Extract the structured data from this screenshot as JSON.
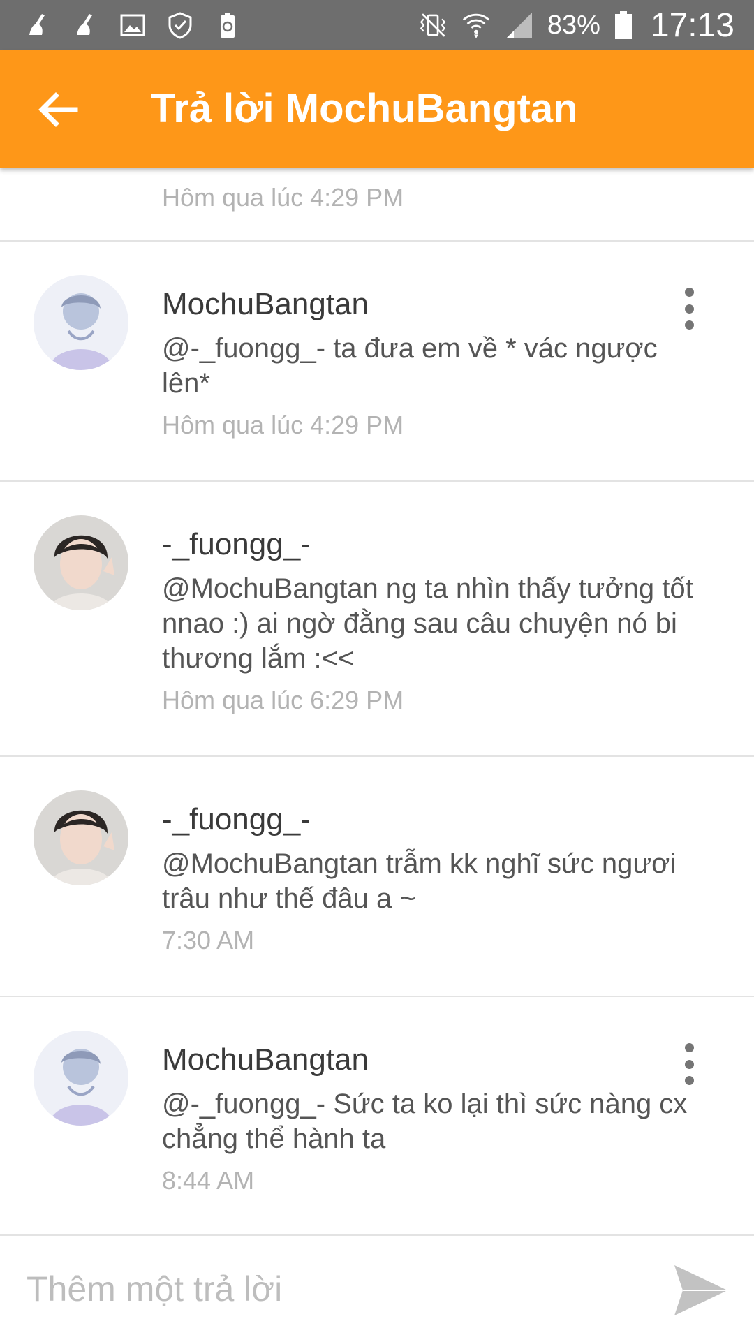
{
  "status_bar": {
    "battery_percent": "83%",
    "time": "17:13",
    "icons": [
      "cleaner-icon",
      "cleaner-icon",
      "gallery-icon",
      "shield-icon",
      "battery-saver-icon",
      "vibrate-icon",
      "wifi-icon",
      "signal-icon",
      "battery-icon"
    ]
  },
  "app_bar": {
    "title": "Trả lời MochuBangtan",
    "back_icon": "arrow-left-icon",
    "background": "#fe9718"
  },
  "partial_comment": {
    "time": "Hôm qua lúc 4:29 PM"
  },
  "comments": [
    {
      "username": "MochuBangtan",
      "text": "@-_fuongg_-   ta đưa em về * vác ngược lên*",
      "time": "Hôm qua lúc 4:29 PM",
      "avatar": "avatar-mochubangtan",
      "has_menu": true
    },
    {
      "username": "-_fuongg_-",
      "text": "@MochuBangtan ng ta nhìn thấy tưởng tốt nnao :) ai ngờ đằng sau câu chuyện nó bi thương lắm :<<",
      "time": "Hôm qua lúc 6:29 PM",
      "avatar": "avatar-fuongg",
      "has_menu": false
    },
    {
      "username": "-_fuongg_-",
      "text": "@MochuBangtan trẫm kk nghĩ sức ngươi trâu như thế đâu a ~",
      "time": "7:30 AM",
      "avatar": "avatar-fuongg",
      "has_menu": false
    },
    {
      "username": "MochuBangtan",
      "text": "@-_fuongg_-   Sức ta ko lại thì sức nàng cx chẳng thể hành ta",
      "time": "8:44 AM",
      "avatar": "avatar-mochubangtan",
      "has_menu": true
    }
  ],
  "reply_bar": {
    "placeholder": "Thêm một trả lời",
    "send_icon": "send-icon"
  },
  "colors": {
    "accent": "#fe9718",
    "status_bar": "#6e6e6e",
    "divider": "#e3e3e3",
    "timestamp": "#b3b3b3"
  }
}
